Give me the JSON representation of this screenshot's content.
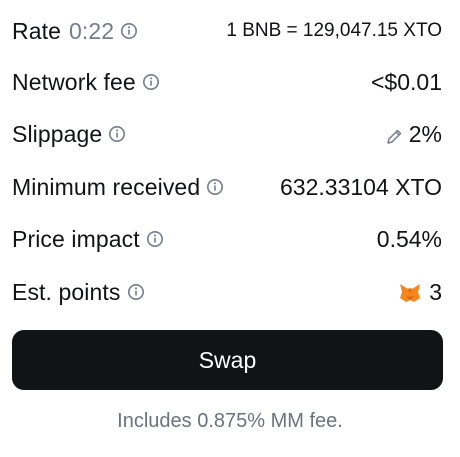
{
  "rate": {
    "label": "Rate",
    "timer": "0:22",
    "value": "1 BNB = 129,047.15 XTO"
  },
  "network_fee": {
    "label": "Network fee",
    "value": "<$0.01"
  },
  "slippage": {
    "label": "Slippage",
    "value": "2%"
  },
  "minimum_received": {
    "label": "Minimum received",
    "value": "632.33104 XTO"
  },
  "price_impact": {
    "label": "Price impact",
    "value": "0.54%"
  },
  "est_points": {
    "label": "Est. points",
    "value": "3"
  },
  "swap_button": {
    "label": "Swap"
  },
  "footer": {
    "text": "Includes 0.875% MM fee."
  },
  "colors": {
    "primary_text": "#121314",
    "muted_text": "#737d8c",
    "button_bg": "#121314",
    "fox_orange": "#f6851b"
  },
  "icons": {
    "info": "info-icon",
    "edit": "pencil-icon",
    "points": "metamask-fox-icon"
  }
}
